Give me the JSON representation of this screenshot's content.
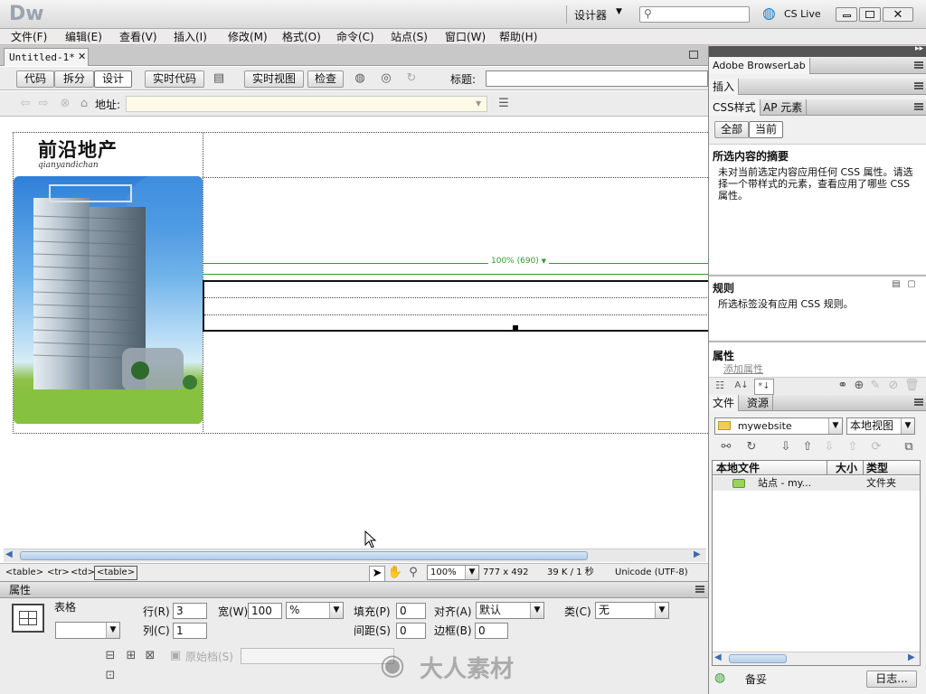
{
  "app": {
    "logo": "Dw",
    "workspace": "设计器",
    "search_placeholder": "",
    "cs_live": "CS Live"
  },
  "menubar": [
    "文件(F)",
    "编辑(E)",
    "查看(V)",
    "插入(I)",
    "修改(M)",
    "格式(O)",
    "命令(C)",
    "站点(S)",
    "窗口(W)",
    "帮助(H)"
  ],
  "document": {
    "tab_name": "Untitled-1*",
    "toolbar": {
      "code": "代码",
      "split": "拆分",
      "design": "设计",
      "live_code": "实时代码",
      "live_view": "实时视图",
      "inspect": "检查",
      "title_label": "标题:",
      "title_value": ""
    },
    "address_label": "地址:",
    "address_value": ""
  },
  "page": {
    "brand_title": "前沿地产",
    "brand_sub": "qianyandichan",
    "table_width_label": "100% (690)"
  },
  "status": {
    "tags": [
      "<table>",
      "<tr>",
      "<td>",
      "<table>"
    ],
    "zoom": "100%",
    "size": "777 x 492",
    "download": "39 K / 1 秒",
    "encoding": "Unicode (UTF-8)"
  },
  "properties": {
    "header": "属性",
    "type_label": "表格",
    "table_name": "",
    "rows_label": "行(R)",
    "rows": "3",
    "cols_label": "列(C)",
    "cols": "1",
    "width_label": "宽(W)",
    "width": "100",
    "width_unit": "%",
    "padding_label": "填充(P)",
    "padding": "0",
    "spacing_label": "间距(S)",
    "spacing": "0",
    "align_label": "对齐(A)",
    "align": "默认",
    "border_label": "边框(B)",
    "border": "0",
    "class_label": "类(C)",
    "class": "无",
    "source_label": "原始档(S)",
    "source_value": ""
  },
  "right": {
    "browserlab": "Adobe BrowserLab",
    "insert": "插入",
    "css_tabs": [
      "CSS样式",
      "AP 元素"
    ],
    "css_modes": [
      "全部",
      "当前"
    ],
    "summary_title": "所选内容的摘要",
    "summary_text": "未对当前选定内容应用任何 CSS 属性。请选择一个带样式的元素，查看应用了哪些 CSS 属性。",
    "rules_title": "规则",
    "rules_text": "所选标签没有应用 CSS 规则。",
    "props_title": "属性",
    "add_prop": "添加属性",
    "files_tabs": [
      "文件",
      "资源"
    ],
    "site": "mywebsite",
    "view": "本地视图",
    "columns": [
      "本地文件",
      "大小",
      "类型"
    ],
    "file_row": {
      "name": "站点 - my...",
      "size": "",
      "type": "文件夹"
    },
    "ready": "备妥",
    "log": "日志..."
  },
  "watermark": "大人素材",
  "colors": {
    "accent": "#1d5fb4",
    "guide_green": "#2e9d2e",
    "panel_bg": "#f0f0f0"
  }
}
